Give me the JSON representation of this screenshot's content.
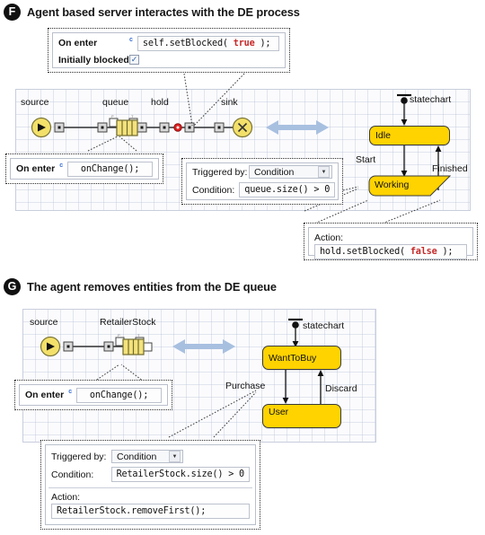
{
  "sections": [
    {
      "badge": "F",
      "title": "Agent based server interactes with the DE process",
      "flowchart": {
        "nodes": [
          {
            "name": "source",
            "label": "source"
          },
          {
            "name": "queue",
            "label": "queue"
          },
          {
            "name": "hold",
            "label": "hold"
          },
          {
            "name": "sink",
            "label": "sink"
          }
        ]
      },
      "statechart": {
        "label": "statechart",
        "states": [
          {
            "name": "idle",
            "label": "Idle"
          },
          {
            "name": "working",
            "label": "Working"
          }
        ],
        "transitions": [
          {
            "name": "start",
            "label": "Start"
          },
          {
            "name": "finished",
            "label": "Finished"
          }
        ]
      },
      "popups": {
        "hold_props": {
          "on_enter_label": "On enter",
          "c_marker": "c",
          "on_enter_code_plain_1": "self.setBlocked( ",
          "on_enter_code_keyword": "true",
          "on_enter_code_plain_2": " );",
          "initially_blocked_label": "Initially blocked",
          "initially_blocked_checked": "✓"
        },
        "queue_props": {
          "on_enter_label": "On enter",
          "c_marker": "c",
          "code": "onChange();"
        },
        "start_transition": {
          "triggered_by_label": "Triggered by:",
          "triggered_by_value": "Condition",
          "condition_label": "Condition:",
          "condition_value": "queue.size() > 0"
        },
        "finished_action": {
          "action_label": "Action:",
          "code_plain_1": "hold.setBlocked( ",
          "code_keyword": "false",
          "code_plain_2": " );"
        }
      }
    },
    {
      "badge": "G",
      "title": "The agent removes entities from the DE queue",
      "flowchart": {
        "nodes": [
          {
            "name": "source",
            "label": "source"
          },
          {
            "name": "retailerstock",
            "label": "RetailerStock"
          }
        ]
      },
      "statechart": {
        "label": "statechart",
        "states": [
          {
            "name": "wanttobuy",
            "label": "WantToBuy"
          },
          {
            "name": "user",
            "label": "User"
          }
        ],
        "transitions": [
          {
            "name": "purchase",
            "label": "Purchase"
          },
          {
            "name": "discard",
            "label": "Discard"
          }
        ]
      },
      "popups": {
        "queue_props": {
          "on_enter_label": "On enter",
          "c_marker": "c",
          "code": "onChange();"
        },
        "purchase_transition": {
          "triggered_by_label": "Triggered by:",
          "triggered_by_value": "Condition",
          "condition_label": "Condition:",
          "condition_value": "RetailerStock.size() > 0",
          "action_label": "Action:",
          "action_code": "RetailerStock.removeFirst();"
        }
      }
    }
  ],
  "colors": {
    "state_yellow": "#FFD300",
    "source_yellow": "#F2E06A",
    "hold_red": "#E02020",
    "arrow_blue": "#A8C0E0",
    "grid": "#b9c3d7",
    "keyword_red": "#c62828"
  },
  "icons": {
    "source": "source-node-icon",
    "queue": "queue-node-icon",
    "hold": "hold-node-icon",
    "sink": "sink-node-icon",
    "port": "port-square-icon",
    "dropdown": "chevron-down-icon",
    "checkbox": "checkbox-checked-icon",
    "double_arrow": "double-arrow-icon",
    "entry_point": "statechart-entry-point-icon"
  }
}
